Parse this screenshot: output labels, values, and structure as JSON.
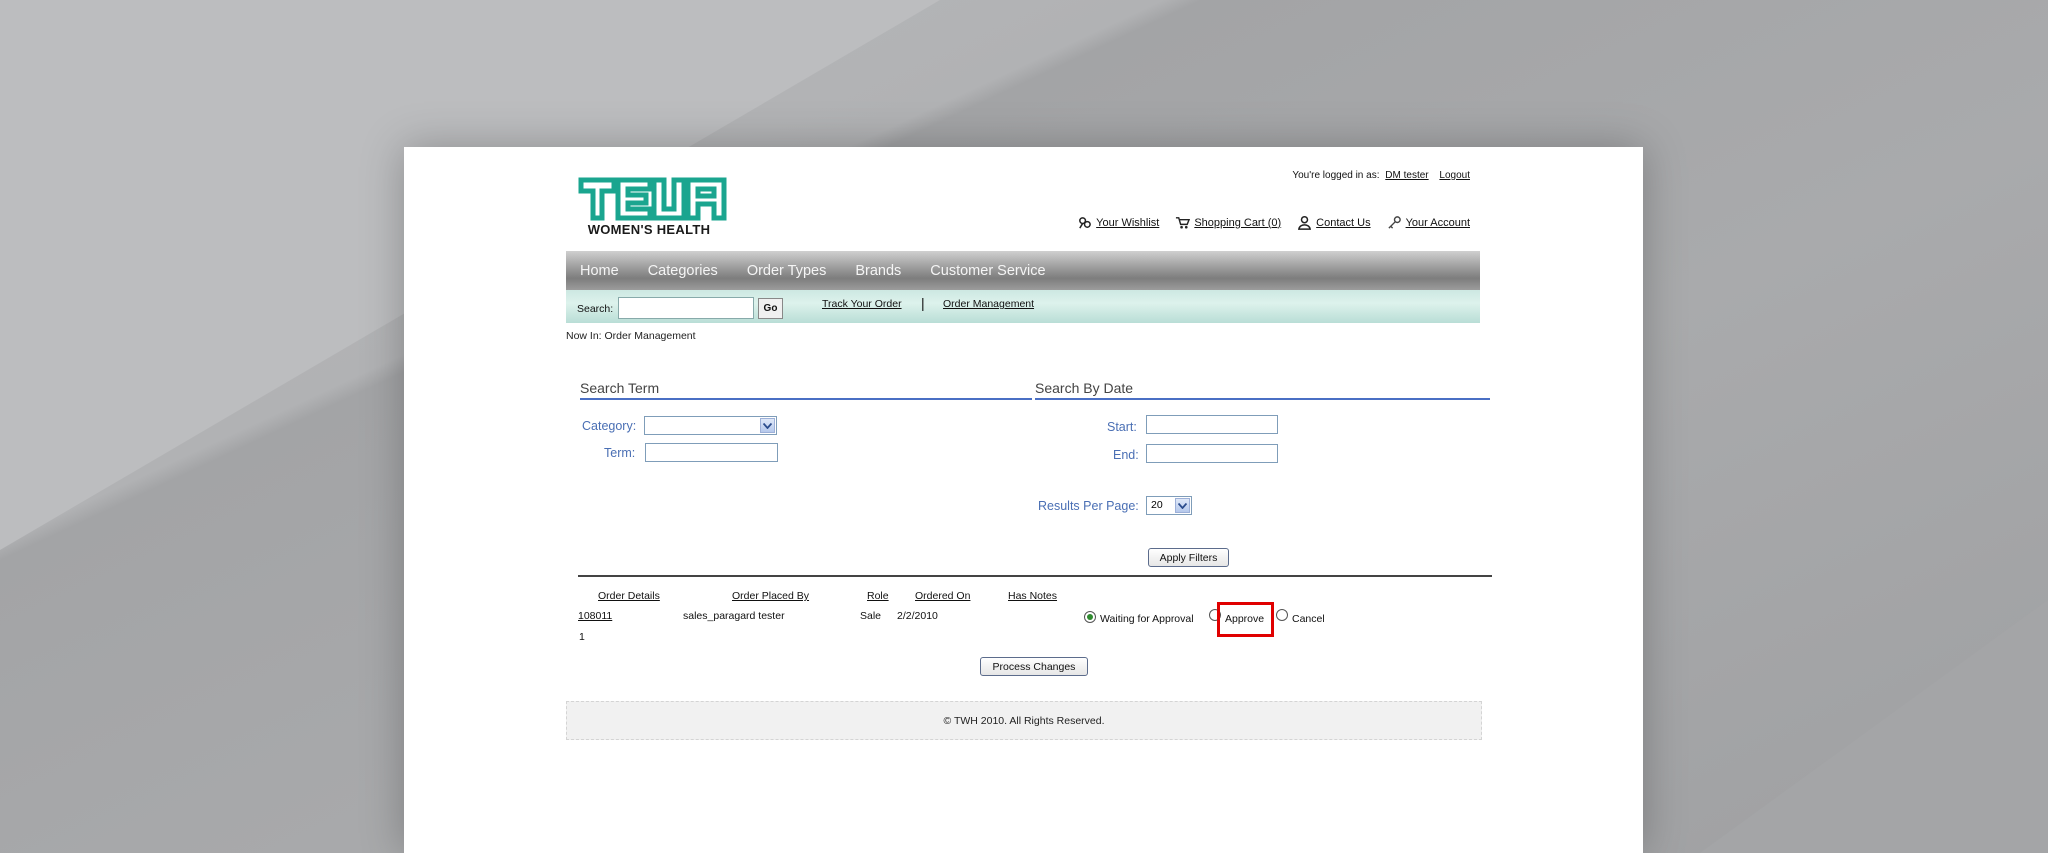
{
  "header": {
    "logo_text": "TEVA",
    "logo_subtitle": "WOMEN'S HEALTH",
    "logged_in_prefix": "You're logged in as:",
    "user_name": "DM tester",
    "logout_label": "Logout",
    "util_links": [
      {
        "label": "Your Wishlist",
        "icon": "wishlist-icon"
      },
      {
        "label": "Shopping Cart (0)",
        "icon": "cart-icon"
      },
      {
        "label": "Contact Us",
        "icon": "contact-icon"
      },
      {
        "label": "Your Account",
        "icon": "key-icon"
      }
    ]
  },
  "nav": {
    "items": [
      "Home",
      "Categories",
      "Order Types",
      "Brands",
      "Customer Service"
    ]
  },
  "subbar": {
    "search_label": "Search:",
    "search_value": "",
    "go_label": "Go",
    "link1": "Track Your Order",
    "separator": "|",
    "link2": "Order Management"
  },
  "breadcrumb": "Now In: Order Management",
  "filters": {
    "search_term_heading": "Search Term",
    "search_date_heading": "Search By Date",
    "category_label": "Category:",
    "category_value": "",
    "term_label": "Term:",
    "start_label": "Start:",
    "end_label": "End:",
    "results_label": "Results Per Page:",
    "results_value": "20",
    "apply_label": "Apply Filters"
  },
  "table": {
    "headers": [
      "Order Details",
      "Order Placed By",
      "Role",
      "Ordered On",
      "Has Notes"
    ],
    "rows": [
      {
        "order_id": "108011",
        "placed_by": "sales_paragard tester",
        "role": "Sale",
        "ordered_on": "2/2/2010",
        "status_waiting": "Waiting for Approval",
        "status_approve": "Approve",
        "status_cancel": "Cancel",
        "selected": "Waiting for Approval"
      }
    ],
    "page_number": "1",
    "process_label": "Process Changes"
  },
  "footer": {
    "copyright": "© TWH 2010. All Rights Reserved."
  },
  "colors": {
    "teva_green": "#1aa58f",
    "label_blue": "#4a6fb4",
    "highlight_red": "#e00000"
  }
}
